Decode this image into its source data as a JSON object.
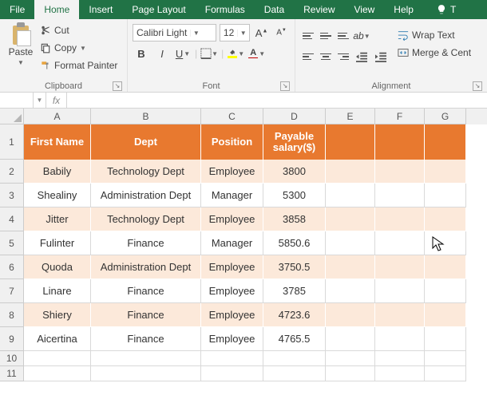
{
  "tabs": [
    "File",
    "Home",
    "Insert",
    "Page Layout",
    "Formulas",
    "Data",
    "Review",
    "View",
    "Help"
  ],
  "active_tab": "Home",
  "tell_me_prefix": "T",
  "ribbon": {
    "clipboard": {
      "paste": "Paste",
      "cut": "Cut",
      "copy": "Copy",
      "format_painter": "Format Painter",
      "label": "Clipboard"
    },
    "font": {
      "name": "Calibri Light",
      "size": "12",
      "label": "Font",
      "fill_color": "#ffff00",
      "font_color": "#c00000"
    },
    "alignment": {
      "wrap": "Wrap Text",
      "merge": "Merge & Cent",
      "label": "Alignment"
    }
  },
  "name_box": "",
  "grid": {
    "columns": [
      "A",
      "B",
      "C",
      "D",
      "E",
      "F",
      "G"
    ],
    "header": [
      "First Name",
      "Dept",
      "Position",
      "Payable salary($)"
    ],
    "rows": [
      {
        "n": 2,
        "band": true,
        "cells": [
          "Babily",
          "Technology Dept",
          "Employee",
          "3800"
        ]
      },
      {
        "n": 3,
        "band": false,
        "cells": [
          "Shealiny",
          "Administration Dept",
          "Manager",
          "5300"
        ]
      },
      {
        "n": 4,
        "band": true,
        "cells": [
          "Jitter",
          "Technology Dept",
          "Employee",
          "3858"
        ]
      },
      {
        "n": 5,
        "band": false,
        "cells": [
          "Fulinter",
          "Finance",
          "Manager",
          "5850.6"
        ]
      },
      {
        "n": 6,
        "band": true,
        "cells": [
          "Quoda",
          "Administration Dept",
          "Employee",
          "3750.5"
        ]
      },
      {
        "n": 7,
        "band": false,
        "cells": [
          "Linare",
          "Finance",
          "Employee",
          "3785"
        ]
      },
      {
        "n": 8,
        "band": true,
        "cells": [
          "Shiery",
          "Finance",
          "Employee",
          "4723.6"
        ]
      },
      {
        "n": 9,
        "band": false,
        "cells": [
          "Aicertina",
          "Finance",
          "Employee",
          "4765.5"
        ]
      }
    ],
    "empty_rows": [
      10,
      11
    ]
  }
}
